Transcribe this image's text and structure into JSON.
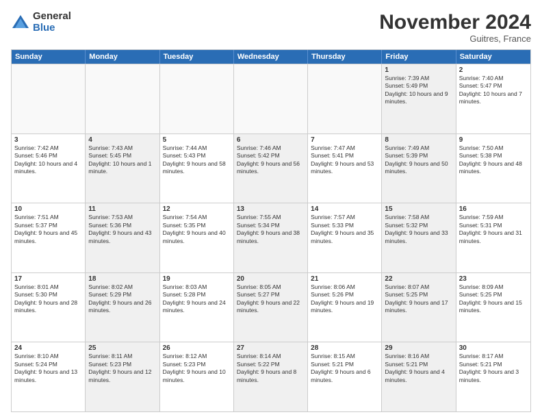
{
  "logo": {
    "general": "General",
    "blue": "Blue"
  },
  "title": "November 2024",
  "location": "Guitres, France",
  "header_days": [
    "Sunday",
    "Monday",
    "Tuesday",
    "Wednesday",
    "Thursday",
    "Friday",
    "Saturday"
  ],
  "weeks": [
    [
      {
        "day": "",
        "sunrise": "",
        "sunset": "",
        "daylight": "",
        "shaded": false,
        "empty": true
      },
      {
        "day": "",
        "sunrise": "",
        "sunset": "",
        "daylight": "",
        "shaded": false,
        "empty": true
      },
      {
        "day": "",
        "sunrise": "",
        "sunset": "",
        "daylight": "",
        "shaded": false,
        "empty": true
      },
      {
        "day": "",
        "sunrise": "",
        "sunset": "",
        "daylight": "",
        "shaded": false,
        "empty": true
      },
      {
        "day": "",
        "sunrise": "",
        "sunset": "",
        "daylight": "",
        "shaded": false,
        "empty": true
      },
      {
        "day": "1",
        "sunrise": "Sunrise: 7:39 AM",
        "sunset": "Sunset: 5:49 PM",
        "daylight": "Daylight: 10 hours and 9 minutes.",
        "shaded": true,
        "empty": false
      },
      {
        "day": "2",
        "sunrise": "Sunrise: 7:40 AM",
        "sunset": "Sunset: 5:47 PM",
        "daylight": "Daylight: 10 hours and 7 minutes.",
        "shaded": false,
        "empty": false
      }
    ],
    [
      {
        "day": "3",
        "sunrise": "Sunrise: 7:42 AM",
        "sunset": "Sunset: 5:46 PM",
        "daylight": "Daylight: 10 hours and 4 minutes.",
        "shaded": false,
        "empty": false
      },
      {
        "day": "4",
        "sunrise": "Sunrise: 7:43 AM",
        "sunset": "Sunset: 5:45 PM",
        "daylight": "Daylight: 10 hours and 1 minute.",
        "shaded": true,
        "empty": false
      },
      {
        "day": "5",
        "sunrise": "Sunrise: 7:44 AM",
        "sunset": "Sunset: 5:43 PM",
        "daylight": "Daylight: 9 hours and 58 minutes.",
        "shaded": false,
        "empty": false
      },
      {
        "day": "6",
        "sunrise": "Sunrise: 7:46 AM",
        "sunset": "Sunset: 5:42 PM",
        "daylight": "Daylight: 9 hours and 56 minutes.",
        "shaded": true,
        "empty": false
      },
      {
        "day": "7",
        "sunrise": "Sunrise: 7:47 AM",
        "sunset": "Sunset: 5:41 PM",
        "daylight": "Daylight: 9 hours and 53 minutes.",
        "shaded": false,
        "empty": false
      },
      {
        "day": "8",
        "sunrise": "Sunrise: 7:49 AM",
        "sunset": "Sunset: 5:39 PM",
        "daylight": "Daylight: 9 hours and 50 minutes.",
        "shaded": true,
        "empty": false
      },
      {
        "day": "9",
        "sunrise": "Sunrise: 7:50 AM",
        "sunset": "Sunset: 5:38 PM",
        "daylight": "Daylight: 9 hours and 48 minutes.",
        "shaded": false,
        "empty": false
      }
    ],
    [
      {
        "day": "10",
        "sunrise": "Sunrise: 7:51 AM",
        "sunset": "Sunset: 5:37 PM",
        "daylight": "Daylight: 9 hours and 45 minutes.",
        "shaded": false,
        "empty": false
      },
      {
        "day": "11",
        "sunrise": "Sunrise: 7:53 AM",
        "sunset": "Sunset: 5:36 PM",
        "daylight": "Daylight: 9 hours and 43 minutes.",
        "shaded": true,
        "empty": false
      },
      {
        "day": "12",
        "sunrise": "Sunrise: 7:54 AM",
        "sunset": "Sunset: 5:35 PM",
        "daylight": "Daylight: 9 hours and 40 minutes.",
        "shaded": false,
        "empty": false
      },
      {
        "day": "13",
        "sunrise": "Sunrise: 7:55 AM",
        "sunset": "Sunset: 5:34 PM",
        "daylight": "Daylight: 9 hours and 38 minutes.",
        "shaded": true,
        "empty": false
      },
      {
        "day": "14",
        "sunrise": "Sunrise: 7:57 AM",
        "sunset": "Sunset: 5:33 PM",
        "daylight": "Daylight: 9 hours and 35 minutes.",
        "shaded": false,
        "empty": false
      },
      {
        "day": "15",
        "sunrise": "Sunrise: 7:58 AM",
        "sunset": "Sunset: 5:32 PM",
        "daylight": "Daylight: 9 hours and 33 minutes.",
        "shaded": true,
        "empty": false
      },
      {
        "day": "16",
        "sunrise": "Sunrise: 7:59 AM",
        "sunset": "Sunset: 5:31 PM",
        "daylight": "Daylight: 9 hours and 31 minutes.",
        "shaded": false,
        "empty": false
      }
    ],
    [
      {
        "day": "17",
        "sunrise": "Sunrise: 8:01 AM",
        "sunset": "Sunset: 5:30 PM",
        "daylight": "Daylight: 9 hours and 28 minutes.",
        "shaded": false,
        "empty": false
      },
      {
        "day": "18",
        "sunrise": "Sunrise: 8:02 AM",
        "sunset": "Sunset: 5:29 PM",
        "daylight": "Daylight: 9 hours and 26 minutes.",
        "shaded": true,
        "empty": false
      },
      {
        "day": "19",
        "sunrise": "Sunrise: 8:03 AM",
        "sunset": "Sunset: 5:28 PM",
        "daylight": "Daylight: 9 hours and 24 minutes.",
        "shaded": false,
        "empty": false
      },
      {
        "day": "20",
        "sunrise": "Sunrise: 8:05 AM",
        "sunset": "Sunset: 5:27 PM",
        "daylight": "Daylight: 9 hours and 22 minutes.",
        "shaded": true,
        "empty": false
      },
      {
        "day": "21",
        "sunrise": "Sunrise: 8:06 AM",
        "sunset": "Sunset: 5:26 PM",
        "daylight": "Daylight: 9 hours and 19 minutes.",
        "shaded": false,
        "empty": false
      },
      {
        "day": "22",
        "sunrise": "Sunrise: 8:07 AM",
        "sunset": "Sunset: 5:25 PM",
        "daylight": "Daylight: 9 hours and 17 minutes.",
        "shaded": true,
        "empty": false
      },
      {
        "day": "23",
        "sunrise": "Sunrise: 8:09 AM",
        "sunset": "Sunset: 5:25 PM",
        "daylight": "Daylight: 9 hours and 15 minutes.",
        "shaded": false,
        "empty": false
      }
    ],
    [
      {
        "day": "24",
        "sunrise": "Sunrise: 8:10 AM",
        "sunset": "Sunset: 5:24 PM",
        "daylight": "Daylight: 9 hours and 13 minutes.",
        "shaded": false,
        "empty": false
      },
      {
        "day": "25",
        "sunrise": "Sunrise: 8:11 AM",
        "sunset": "Sunset: 5:23 PM",
        "daylight": "Daylight: 9 hours and 12 minutes.",
        "shaded": true,
        "empty": false
      },
      {
        "day": "26",
        "sunrise": "Sunrise: 8:12 AM",
        "sunset": "Sunset: 5:23 PM",
        "daylight": "Daylight: 9 hours and 10 minutes.",
        "shaded": false,
        "empty": false
      },
      {
        "day": "27",
        "sunrise": "Sunrise: 8:14 AM",
        "sunset": "Sunset: 5:22 PM",
        "daylight": "Daylight: 9 hours and 8 minutes.",
        "shaded": true,
        "empty": false
      },
      {
        "day": "28",
        "sunrise": "Sunrise: 8:15 AM",
        "sunset": "Sunset: 5:21 PM",
        "daylight": "Daylight: 9 hours and 6 minutes.",
        "shaded": false,
        "empty": false
      },
      {
        "day": "29",
        "sunrise": "Sunrise: 8:16 AM",
        "sunset": "Sunset: 5:21 PM",
        "daylight": "Daylight: 9 hours and 4 minutes.",
        "shaded": true,
        "empty": false
      },
      {
        "day": "30",
        "sunrise": "Sunrise: 8:17 AM",
        "sunset": "Sunset: 5:21 PM",
        "daylight": "Daylight: 9 hours and 3 minutes.",
        "shaded": false,
        "empty": false
      }
    ]
  ]
}
